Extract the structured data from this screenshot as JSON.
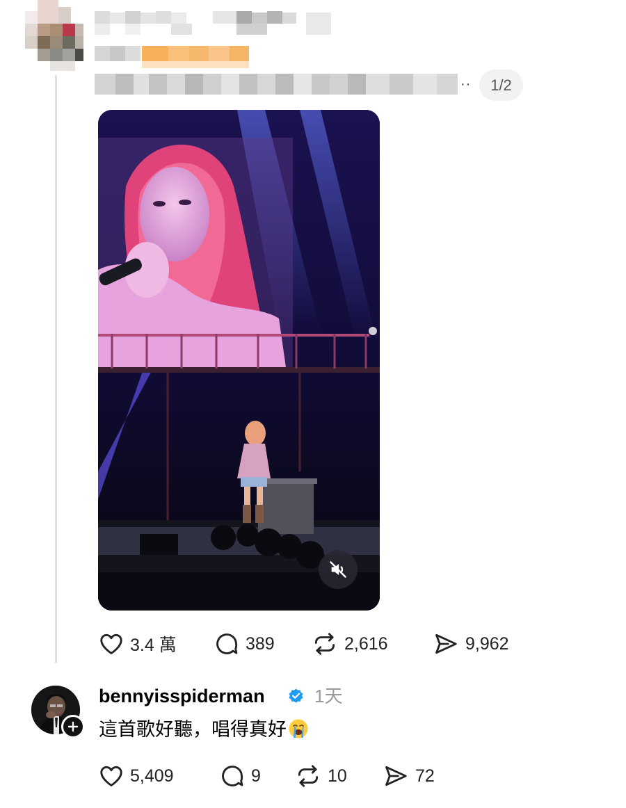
{
  "post": {
    "pager": "1/2",
    "more_glyph": "··",
    "stats": {
      "likes": "3.4 萬",
      "comments": "389",
      "reposts": "2,616",
      "shares": "9,962"
    }
  },
  "reply": {
    "username": "bennyisspiderman",
    "time": "1天",
    "text": "這首歌好聽，唱得真好",
    "stats": {
      "likes": "5,409",
      "comments": "9",
      "reposts": "10",
      "shares": "72"
    }
  },
  "icons": {
    "like": "heart-icon",
    "comment": "comment-bubble-icon",
    "repost": "repost-icon",
    "share": "send-icon",
    "mute": "muted-speaker-icon",
    "verified": "verified-badge-icon",
    "follow": "plus-icon"
  },
  "colors": {
    "verified": "#1d9bf0",
    "pixelated_accent": "#f7b15b",
    "thread_line": "#e1e1e1",
    "muted_text": "#999999"
  }
}
